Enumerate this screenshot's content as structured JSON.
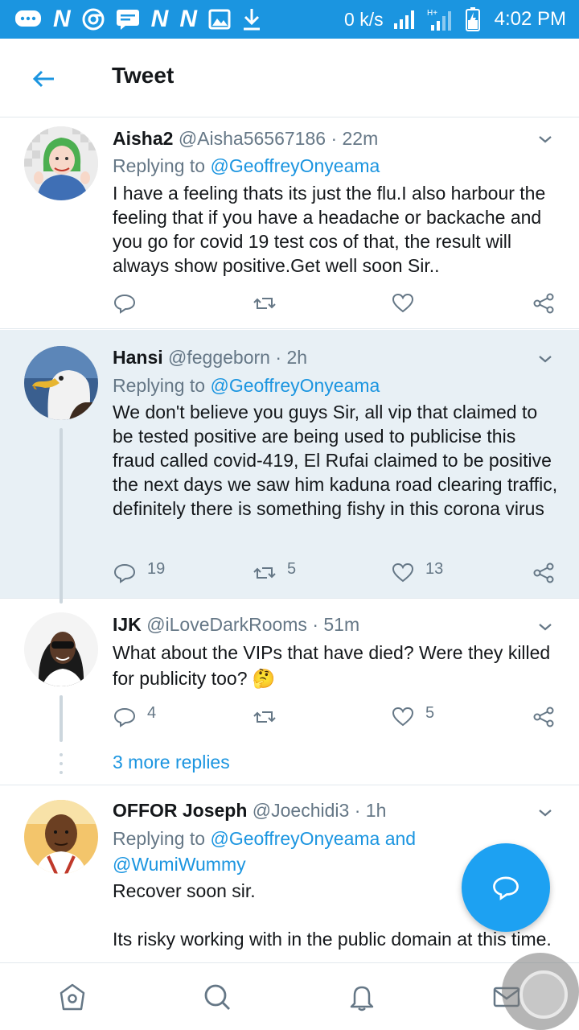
{
  "status_bar": {
    "net_speed": "0 k/s",
    "time": "4:02 PM",
    "network_type": "H+",
    "icons": [
      "chat-bubble-icon",
      "n-icon",
      "chrome-icon",
      "message-icon",
      "n-icon",
      "n-icon",
      "gallery-icon",
      "download-icon",
      "signal-icon",
      "signal-icon",
      "battery-charging-icon"
    ]
  },
  "header": {
    "title": "Tweet",
    "back_icon": "arrow-left-icon"
  },
  "tweets": [
    {
      "name": "Aisha2",
      "handle": "@Aisha56567186",
      "time": "22m",
      "replying_prefix": "Replying to",
      "replying_to": "@GeoffreyOnyeama",
      "text": "I have a feeling thats its just the flu.I also harbour the feeling that if you have a headache or backache and you go for covid 19 test cos of that, the result will always show positive.Get well soon Sir..",
      "replies": "",
      "retweets": "",
      "likes": ""
    },
    {
      "name": "Hansi",
      "handle": "@feggeborn",
      "time": "2h",
      "replying_prefix": "Replying to",
      "replying_to": "@GeoffreyOnyeama",
      "text": "We don't believe you guys Sir, all vip that claimed to be tested positive are being used to publicise this fraud called covid-419, El Rufai claimed to be positive the next days we saw him kaduna road clearing traffic, definitely there is something fishy in this corona virus",
      "replies": "19",
      "retweets": "5",
      "likes": "13"
    },
    {
      "name": "IJK",
      "handle": "@iLoveDarkRooms",
      "time": "51m",
      "text": "What about the VIPs that have died? Were they killed for publicity too? 🤔",
      "replies": "4",
      "retweets": "",
      "likes": "5"
    },
    {
      "name": "OFFOR Joseph",
      "handle": "@Joechidi3",
      "time": "1h",
      "replying_prefix": "Replying to",
      "replying_to": "@GeoffreyOnyeama and",
      "replying_to_2": "@WumiWummy",
      "text1": "Recover soon sir.",
      "text2": "Its risky working with in the public domain at this time."
    }
  ],
  "more_replies": "3 more replies",
  "colors": {
    "brand": "#1b95e0",
    "text": "#14171a",
    "muted": "#657786",
    "highlight": "#e8f0f5"
  }
}
